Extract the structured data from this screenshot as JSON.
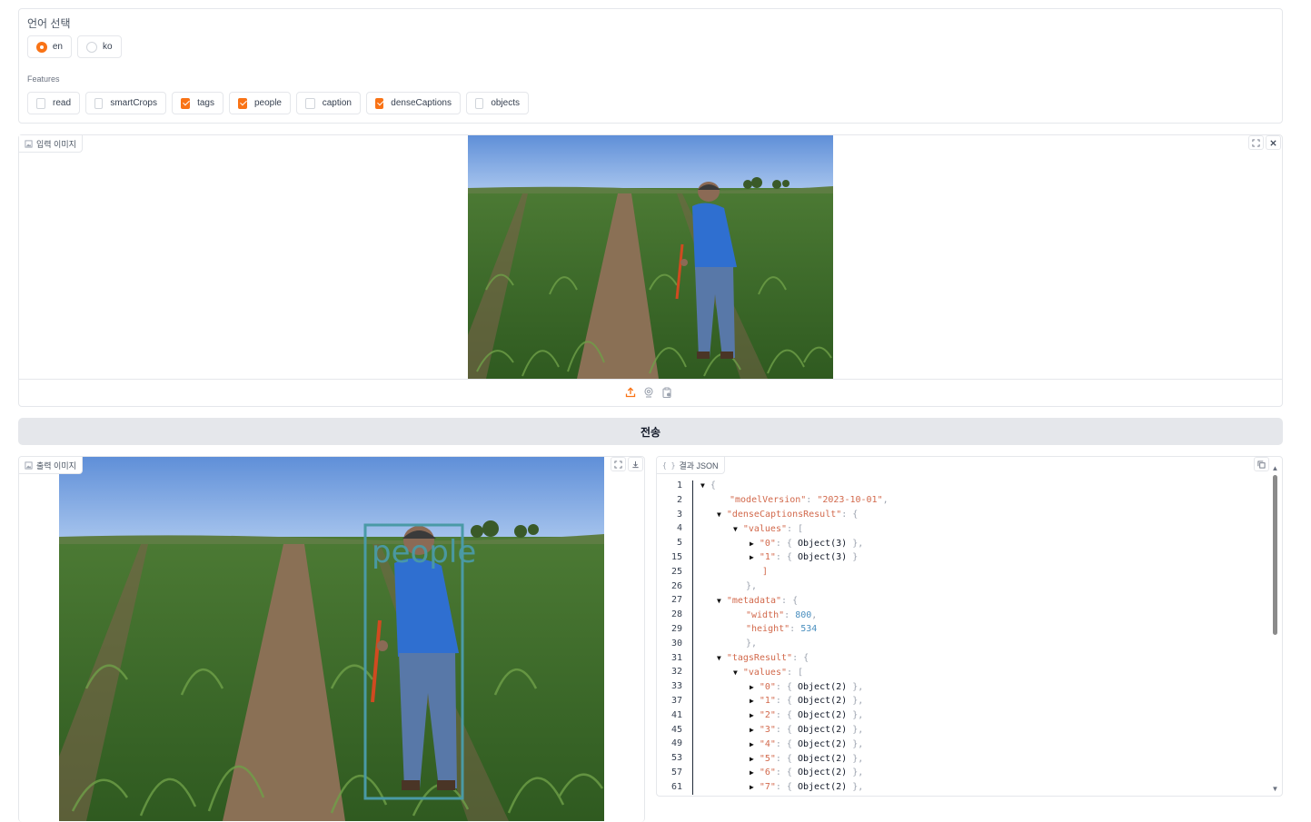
{
  "language": {
    "label": "언어 선택",
    "options": [
      {
        "label": "en",
        "selected": true
      },
      {
        "label": "ko",
        "selected": false
      }
    ]
  },
  "features": {
    "label": "Features",
    "options": [
      {
        "label": "read",
        "checked": false
      },
      {
        "label": "smartCrops",
        "checked": false
      },
      {
        "label": "tags",
        "checked": true
      },
      {
        "label": "people",
        "checked": true
      },
      {
        "label": "caption",
        "checked": false
      },
      {
        "label": "denseCaptions",
        "checked": true
      },
      {
        "label": "objects",
        "checked": false
      }
    ]
  },
  "input_image": {
    "label": "입력 이미지",
    "toolbar": [
      "upload-icon",
      "webcam-icon",
      "clipboard-icon"
    ]
  },
  "submit": {
    "label": "전송"
  },
  "output_image": {
    "label": "출력 이미지",
    "detection_label": "people"
  },
  "result_json": {
    "label": "결과 JSON",
    "lines": [
      {
        "num": "1",
        "indent": 0,
        "tri": "▼",
        "parts": [
          {
            "t": "{",
            "c": "p"
          }
        ]
      },
      {
        "num": "2",
        "indent": 1,
        "tri": "",
        "parts": [
          {
            "t": "\"modelVersion\"",
            "c": "k"
          },
          {
            "t": ": ",
            "c": "p"
          },
          {
            "t": "\"2023-10-01\"",
            "c": "s"
          },
          {
            "t": ",",
            "c": "p"
          }
        ]
      },
      {
        "num": "3",
        "indent": 1,
        "tri": "▼",
        "parts": [
          {
            "t": "\"denseCaptionsResult\"",
            "c": "k"
          },
          {
            "t": ": {",
            "c": "p"
          }
        ]
      },
      {
        "num": "4",
        "indent": 2,
        "tri": "▼",
        "parts": [
          {
            "t": "\"values\"",
            "c": "k"
          },
          {
            "t": ": [",
            "c": "p"
          }
        ]
      },
      {
        "num": "5",
        "indent": 3,
        "tri": "▶",
        "parts": [
          {
            "t": "\"0\"",
            "c": "k"
          },
          {
            "t": ": { ",
            "c": "p"
          },
          {
            "t": "Object(3)",
            "c": "o"
          },
          {
            "t": " },",
            "c": "p"
          }
        ]
      },
      {
        "num": "15",
        "indent": 3,
        "tri": "▶",
        "parts": [
          {
            "t": "\"1\"",
            "c": "k"
          },
          {
            "t": ": { ",
            "c": "p"
          },
          {
            "t": "Object(3)",
            "c": "o"
          },
          {
            "t": " }",
            "c": "p"
          }
        ]
      },
      {
        "num": "25",
        "indent": 3,
        "tri": "",
        "parts": [
          {
            "t": "]",
            "c": "k"
          }
        ]
      },
      {
        "num": "26",
        "indent": 2,
        "tri": "",
        "parts": [
          {
            "t": "},",
            "c": "p"
          }
        ]
      },
      {
        "num": "27",
        "indent": 1,
        "tri": "▼",
        "parts": [
          {
            "t": "\"metadata\"",
            "c": "k"
          },
          {
            "t": ": {",
            "c": "p"
          }
        ]
      },
      {
        "num": "28",
        "indent": 2,
        "tri": "",
        "parts": [
          {
            "t": "\"width\"",
            "c": "k"
          },
          {
            "t": ": ",
            "c": "p"
          },
          {
            "t": "800",
            "c": "n"
          },
          {
            "t": ",",
            "c": "p"
          }
        ]
      },
      {
        "num": "29",
        "indent": 2,
        "tri": "",
        "parts": [
          {
            "t": "\"height\"",
            "c": "k"
          },
          {
            "t": ": ",
            "c": "p"
          },
          {
            "t": "534",
            "c": "n"
          }
        ]
      },
      {
        "num": "30",
        "indent": 2,
        "tri": "",
        "parts": [
          {
            "t": "},",
            "c": "p"
          }
        ]
      },
      {
        "num": "31",
        "indent": 1,
        "tri": "▼",
        "parts": [
          {
            "t": "\"tagsResult\"",
            "c": "k"
          },
          {
            "t": ": {",
            "c": "p"
          }
        ]
      },
      {
        "num": "32",
        "indent": 2,
        "tri": "▼",
        "parts": [
          {
            "t": "\"values\"",
            "c": "k"
          },
          {
            "t": ": [",
            "c": "p"
          }
        ]
      },
      {
        "num": "33",
        "indent": 3,
        "tri": "▶",
        "parts": [
          {
            "t": "\"0\"",
            "c": "k"
          },
          {
            "t": ": { ",
            "c": "p"
          },
          {
            "t": "Object(2)",
            "c": "o"
          },
          {
            "t": " },",
            "c": "p"
          }
        ]
      },
      {
        "num": "37",
        "indent": 3,
        "tri": "▶",
        "parts": [
          {
            "t": "\"1\"",
            "c": "k"
          },
          {
            "t": ": { ",
            "c": "p"
          },
          {
            "t": "Object(2)",
            "c": "o"
          },
          {
            "t": " },",
            "c": "p"
          }
        ]
      },
      {
        "num": "41",
        "indent": 3,
        "tri": "▶",
        "parts": [
          {
            "t": "\"2\"",
            "c": "k"
          },
          {
            "t": ": { ",
            "c": "p"
          },
          {
            "t": "Object(2)",
            "c": "o"
          },
          {
            "t": " },",
            "c": "p"
          }
        ]
      },
      {
        "num": "45",
        "indent": 3,
        "tri": "▶",
        "parts": [
          {
            "t": "\"3\"",
            "c": "k"
          },
          {
            "t": ": { ",
            "c": "p"
          },
          {
            "t": "Object(2)",
            "c": "o"
          },
          {
            "t": " },",
            "c": "p"
          }
        ]
      },
      {
        "num": "49",
        "indent": 3,
        "tri": "▶",
        "parts": [
          {
            "t": "\"4\"",
            "c": "k"
          },
          {
            "t": ": { ",
            "c": "p"
          },
          {
            "t": "Object(2)",
            "c": "o"
          },
          {
            "t": " },",
            "c": "p"
          }
        ]
      },
      {
        "num": "53",
        "indent": 3,
        "tri": "▶",
        "parts": [
          {
            "t": "\"5\"",
            "c": "k"
          },
          {
            "t": ": { ",
            "c": "p"
          },
          {
            "t": "Object(2)",
            "c": "o"
          },
          {
            "t": " },",
            "c": "p"
          }
        ]
      },
      {
        "num": "57",
        "indent": 3,
        "tri": "▶",
        "parts": [
          {
            "t": "\"6\"",
            "c": "k"
          },
          {
            "t": ": { ",
            "c": "p"
          },
          {
            "t": "Object(2)",
            "c": "o"
          },
          {
            "t": " },",
            "c": "p"
          }
        ]
      },
      {
        "num": "61",
        "indent": 3,
        "tri": "▶",
        "parts": [
          {
            "t": "\"7\"",
            "c": "k"
          },
          {
            "t": ": { ",
            "c": "p"
          },
          {
            "t": "Object(2)",
            "c": "o"
          },
          {
            "t": " },",
            "c": "p"
          }
        ]
      }
    ]
  },
  "colors": {
    "accent": "#f97316",
    "detection_box": "#4a9aa6",
    "button_bg": "#e5e7eb"
  }
}
